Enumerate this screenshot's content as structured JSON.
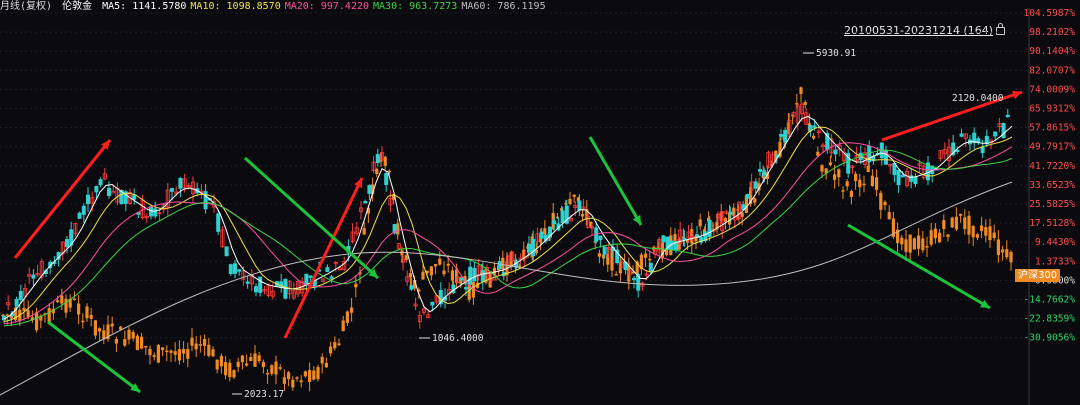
{
  "header": {
    "period": "月线(复权)",
    "symbol": "伦敦金",
    "ma": [
      {
        "label": "MA5:",
        "value": "1141.5780",
        "color": "#ffffff"
      },
      {
        "label": "MA10:",
        "value": "1098.8570",
        "color": "#f0e14a"
      },
      {
        "label": "MA20:",
        "value": "997.4220",
        "color": "#ff4fa0"
      },
      {
        "label": "MA30:",
        "value": "963.7273",
        "color": "#3fd34a"
      },
      {
        "label": "MA60:",
        "value": "786.1195",
        "color": "#bfbfbf"
      }
    ]
  },
  "range_label": "20100531-20231214 (164)",
  "index_badge": "沪深300",
  "chart_data": {
    "type": "candlestick",
    "title": "",
    "right_axis_percent_labels": [
      "104.5987%",
      "98.2102%",
      "90.1404%",
      "82.0707%",
      "74.0009%",
      "65.9312%",
      "57.8615%",
      "49.7917%",
      "41.7220%",
      "33.6523%",
      "25.5825%",
      "17.5128%",
      "9.4430%",
      "1.3733%",
      "0.0000%",
      "-14.7662%",
      "-22.8359%",
      "-30.9056%"
    ],
    "annotations": [
      "5930.91",
      "2120.0400",
      "1046.4000",
      "2023.17"
    ],
    "grid": true,
    "colors": {
      "up": "#ff3b3b",
      "down": "#2fd0d0",
      "index": "#f08a24",
      "trend_up": "#ff1e1e",
      "trend_down": "#1bc43a",
      "background": "#0b0b0f"
    }
  }
}
